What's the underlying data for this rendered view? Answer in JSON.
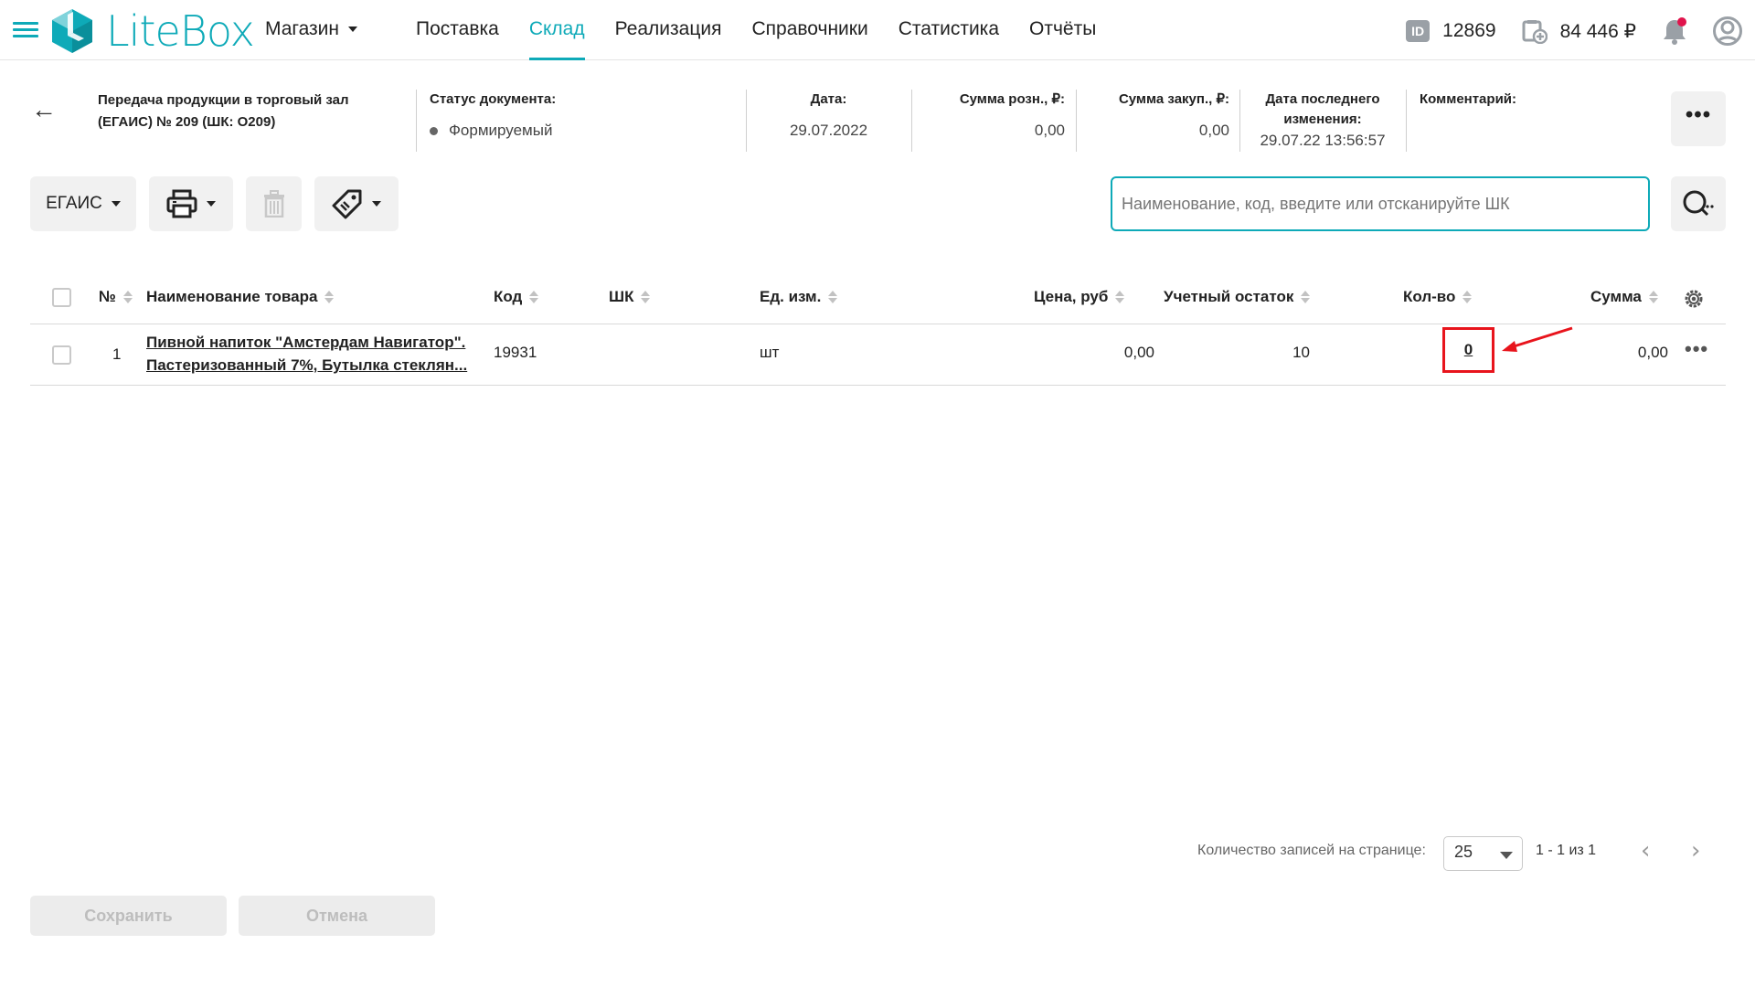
{
  "app": {
    "brand": "LiteBox",
    "store": "Магазин"
  },
  "nav": {
    "items": [
      "Поставка",
      "Склад",
      "Реализация",
      "Справочники",
      "Статистика",
      "Отчёты"
    ],
    "active": "Склад"
  },
  "account": {
    "id_icon": "ID",
    "id": "12869",
    "balance": "84 446 ₽"
  },
  "document": {
    "title_line1": "Передача продукции в торговый зал",
    "title_line2": "(ЕГАИС) № 209 (ШК: О209)",
    "status_label": "Статус документа:",
    "status_value": "Формируемый",
    "date_label": "Дата:",
    "date_value": "29.07.2022",
    "retail_label": "Сумма розн., ₽:",
    "retail_value": "0,00",
    "purchase_label": "Сумма закуп., ₽:",
    "purchase_value": "0,00",
    "modified_label_line1": "Дата последнего",
    "modified_label_line2": "изменения:",
    "modified_value": "29.07.22 13:56:57",
    "comment_label": "Комментарий:"
  },
  "toolbar": {
    "egais_label": "ЕГАИС",
    "search_placeholder": "Наименование, код, введите или отсканируйте ШК"
  },
  "table": {
    "headers": {
      "num": "№",
      "name": "Наименование товара",
      "code": "Код",
      "barcode": "ШК",
      "unit": "Ед. изм.",
      "price": "Цена, руб",
      "stock": "Учетный остаток",
      "qty": "Кол-во",
      "sum": "Сумма"
    },
    "rows": [
      {
        "num": "1",
        "name_line1": "Пивной напиток \"Амстердам Навигатор\".",
        "name_line2": "Пастеризованный 7%, Бутылка стеклян...",
        "code": "19931",
        "barcode": "",
        "unit": "шт",
        "price": "0,00",
        "stock": "10",
        "qty": "0",
        "sum": "0,00"
      }
    ]
  },
  "pagination": {
    "label": "Количество записей на странице:",
    "page_size": "25",
    "range": "1 - 1 из 1"
  },
  "footer": {
    "save_label": "Сохранить",
    "cancel_label": "Отмена"
  },
  "colors": {
    "accent": "#0eaab8",
    "highlight": "#e8141c",
    "notification_dot": "#e0144c"
  }
}
